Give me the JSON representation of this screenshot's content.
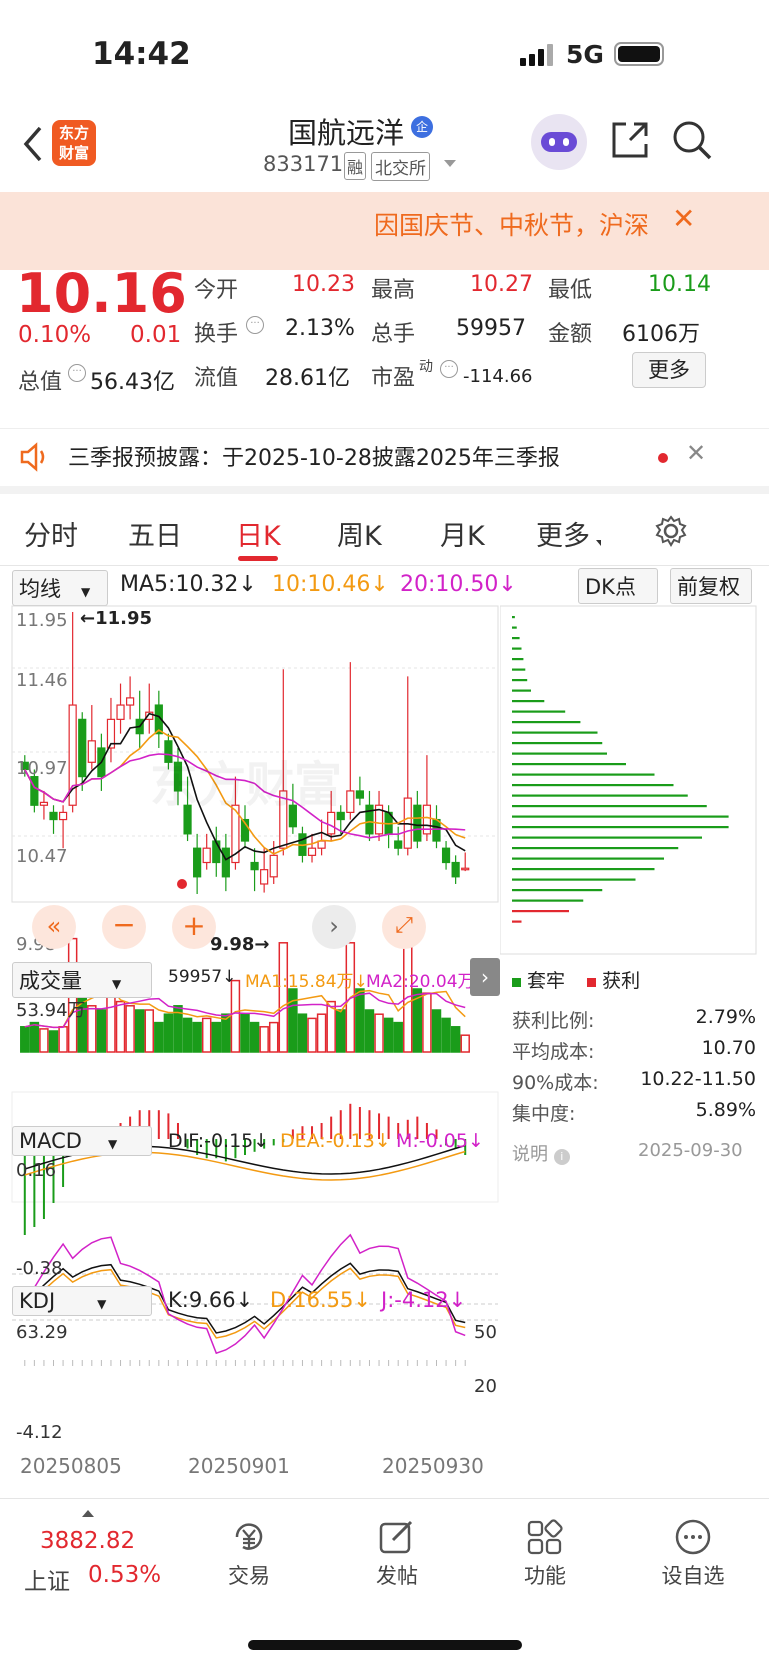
{
  "status_bar": {
    "time": "14:42",
    "network": "5G"
  },
  "header": {
    "title": "国航远洋",
    "code": "833171",
    "tag_margin": "融",
    "tag_exchange": "北交所",
    "logo_line1": "东方",
    "logo_line2": "财富",
    "badge": "企"
  },
  "banner": {
    "text": "因国庆节、中秋节，沪深",
    "close": "✕"
  },
  "quote": {
    "price": "10.16",
    "change_pct": "0.10%",
    "change_abs": "0.01",
    "open_label": "今开",
    "open": "10.23",
    "high_label": "最高",
    "high": "10.27",
    "low_label": "最低",
    "low": "10.14",
    "turnover_label": "换手",
    "turnover": "2.13%",
    "volume_label": "总手",
    "volume": "59957",
    "amount_label": "金额",
    "amount": "6106万",
    "mcap_label": "总值",
    "mcap": "56.43亿",
    "float_label": "流值",
    "float_val": "28.61亿",
    "pe_label": "市盈",
    "pe_sup": "动",
    "pe": "-114.66",
    "more": "更多"
  },
  "notice": {
    "text": "三季报预披露：于2025-10-28披露2025年三季报"
  },
  "tabs": [
    "分时",
    "五日",
    "日K",
    "周K",
    "月K",
    "更多",
    "设置"
  ],
  "ma_bar": {
    "selector": "均线",
    "ma5": "MA5:10.32↓",
    "ma10": "10:10.46↓",
    "ma20": "20:10.50↓",
    "dk": "DK点",
    "adjust": "前复权"
  },
  "chart": {
    "y_labels": [
      "11.95",
      "11.46",
      "10.97",
      "10.47",
      "9.98"
    ],
    "max_marker": "←11.95",
    "min_marker": "9.98→",
    "watermark": "东方财富",
    "volume_selector": "成交量",
    "volume_val": "59957↓",
    "vol_ma1": "MA1:15.84万↓",
    "vol_ma2": "MA2:20.04万↓",
    "vol_max": "53.94万",
    "macd_selector": "MACD",
    "dif": "DIF:-0.15↓",
    "dea": "DEA:-0.13↓",
    "m": "M:-0.05↓",
    "macd_top": "0.16",
    "macd_bot": "-0.38",
    "kdj_selector": "KDJ",
    "k": "K:9.66↓",
    "d": "D:16.55↓",
    "j": "J:-4.12↓",
    "kdj_top": "63.29",
    "kdj_bot": "-4.12",
    "kdj_50": "50",
    "kdj_20": "20",
    "dates": [
      "20250805",
      "20250901",
      "20250930"
    ]
  },
  "chip": {
    "legend_trap": "套牢",
    "legend_profit": "获利",
    "rows": [
      {
        "label": "获利比例:",
        "value": "2.79%"
      },
      {
        "label": "平均成本:",
        "value": "10.70"
      },
      {
        "label": "90%成本:",
        "value": "10.22-11.50"
      },
      {
        "label": "集中度:",
        "value": "5.89%"
      }
    ],
    "note": "说明",
    "date": "2025-09-30"
  },
  "bottom": {
    "index_val": "3882.82",
    "index_name": "上证",
    "index_pct": "0.53%",
    "trade": "交易",
    "post": "发帖",
    "func": "功能",
    "watch": "设自选"
  },
  "colors": {
    "up": "#e2282f",
    "down": "#1a9c1a",
    "ma10": "#f39a12",
    "ma20": "#d222c8"
  }
}
